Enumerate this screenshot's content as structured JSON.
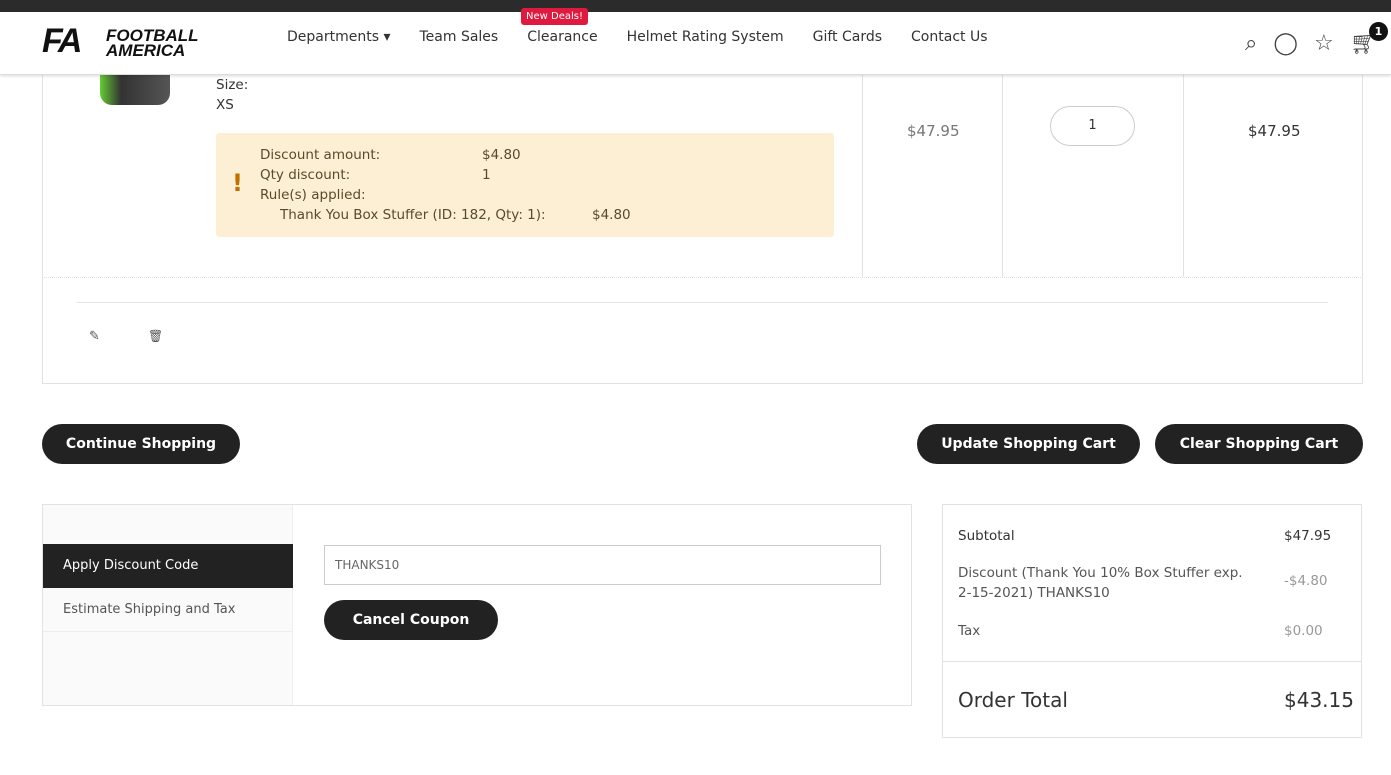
{
  "header": {
    "logo_mark": "FA",
    "logo_line1": "FOOTBALL",
    "logo_line2": "AMERICA",
    "badge": "New Deals!",
    "nav": [
      "Departments ▾",
      "Team Sales",
      "Clearance",
      "Helmet Rating System",
      "Gift Cards",
      "Contact Us"
    ],
    "cart_count": "1"
  },
  "item": {
    "size_label": "Size:",
    "size_value": "XS",
    "price": "$47.95",
    "qty": "1",
    "subtotal": "$47.95",
    "discount": {
      "amount_label": "Discount amount:",
      "amount": "$4.80",
      "qty_label": "Qty discount:",
      "qty": "1",
      "rules_label": "Rule(s) applied:",
      "rule": "Thank You Box Stuffer (ID: 182, Qty: 1):",
      "rule_amount": "$4.80"
    }
  },
  "buttons": {
    "continue": "Continue Shopping",
    "update": "Update Shopping Cart",
    "clear": "Clear Shopping Cart",
    "cancel_coupon": "Cancel Coupon"
  },
  "tabs": [
    "Apply Discount Code",
    "Estimate Shipping and Tax"
  ],
  "coupon": {
    "value": "THANKS10"
  },
  "summary": {
    "subtotal_label": "Subtotal",
    "subtotal": "$47.95",
    "discount_label": "Discount (Thank You 10% Box Stuffer exp. 2-15-2021) THANKS10",
    "discount": "-$4.80",
    "tax_label": "Tax",
    "tax": "$0.00",
    "total_label": "Order Total",
    "total": "$43.15"
  }
}
